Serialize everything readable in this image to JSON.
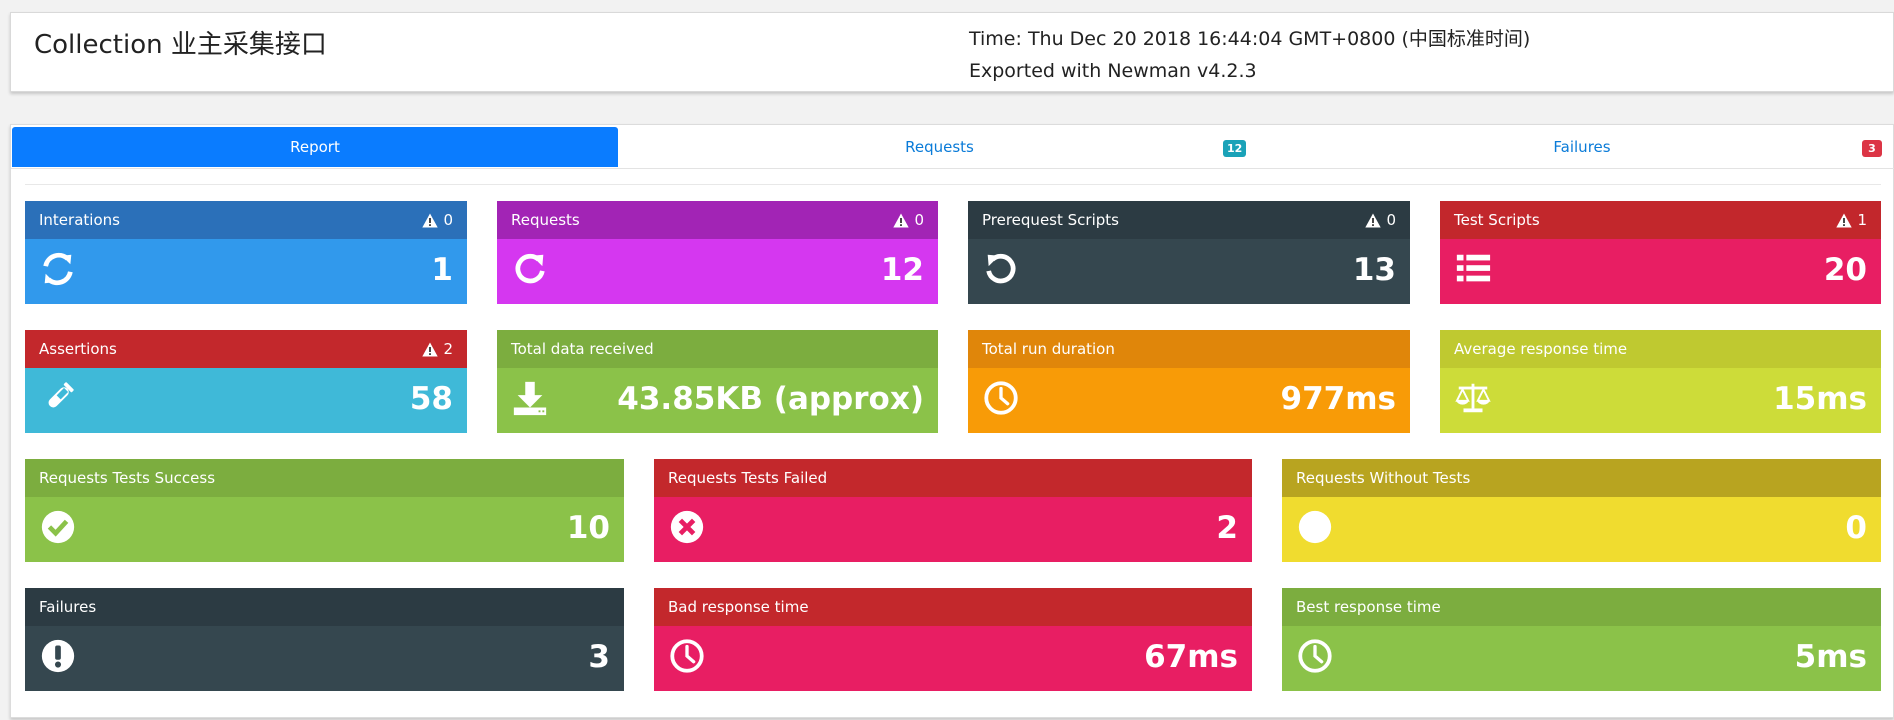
{
  "header": {
    "title": "Collection 业主采集接口",
    "time": "Time: Thu Dec 20 2018 16:44:04 GMT+0800 (中国标准时间)",
    "exported": "Exported with Newman v4.2.3"
  },
  "tabs": [
    {
      "label": "Report",
      "active": true
    },
    {
      "label": "Requests",
      "badge": "12"
    },
    {
      "label": "Failures",
      "badge": "3"
    }
  ],
  "tiles": [
    {
      "title": "Interations",
      "warn": "0",
      "value": "1",
      "icon": "sync-icon",
      "head_color": "#2b70b9",
      "body_color": "#3199ec"
    },
    {
      "title": "Requests",
      "warn": "0",
      "value": "12",
      "icon": "redo-icon",
      "head_color": "#a224b5",
      "body_color": "#d537f0"
    },
    {
      "title": "Prerequest Scripts",
      "warn": "0",
      "value": "13",
      "icon": "undo-icon",
      "head_color": "#2c3b43",
      "body_color": "#35474f"
    },
    {
      "title": "Test Scripts",
      "warn": "1",
      "value": "20",
      "icon": "list-icon",
      "head_color": "#c2272c",
      "body_color": "#e81e63"
    },
    {
      "title": "Assertions",
      "warn": "2",
      "value": "58",
      "icon": "flask-icon",
      "head_color": "#c3282c",
      "body_color": "#3fb9d8"
    },
    {
      "title": "Total data received",
      "value": "43.85KB (approx)",
      "icon": "download-icon",
      "head_color": "#7cad3f",
      "body_color": "#8bc249"
    },
    {
      "title": "Total run duration",
      "value": "977ms",
      "icon": "clock-icon",
      "head_color": "#e0860a",
      "body_color": "#f89b07"
    },
    {
      "title": "Average response time",
      "value": "15ms",
      "icon": "balance-scale-icon",
      "head_color": "#bfc930",
      "body_color": "#cddc39"
    },
    {
      "title": "Requests Tests Success",
      "value": "10",
      "icon": "check-circle-icon",
      "head_color": "#7cad3f",
      "body_color": "#8bc249"
    },
    {
      "title": "Requests Tests Failed",
      "value": "2",
      "icon": "times-circle-icon",
      "head_color": "#c3282c",
      "body_color": "#e81e63"
    },
    {
      "title": "Requests Without Tests",
      "value": "0",
      "icon": "circle-icon",
      "head_color": "#b8a420",
      "body_color": "#f0dc2f"
    },
    {
      "title": "Failures",
      "value": "3",
      "icon": "exclamation-circle-icon",
      "head_color": "#2c3b43",
      "body_color": "#35474f"
    },
    {
      "title": "Bad response time",
      "value": "67ms",
      "icon": "clock-icon",
      "head_color": "#c3282c",
      "body_color": "#e81e63"
    },
    {
      "title": "Best response time",
      "value": "5ms",
      "icon": "clock-icon",
      "head_color": "#7cad3f",
      "body_color": "#8bc249"
    }
  ]
}
